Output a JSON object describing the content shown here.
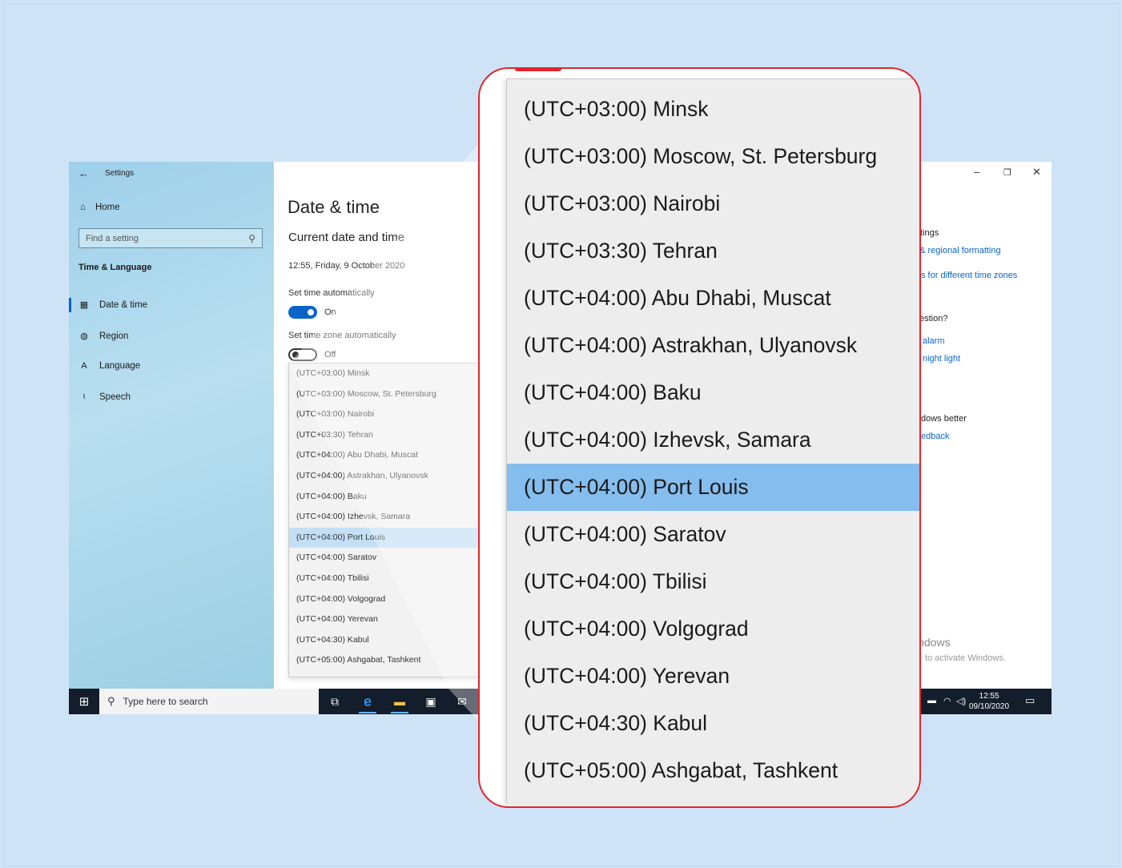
{
  "window": {
    "title": "Settings",
    "minimize": "–",
    "restore": "❐",
    "close": "✕"
  },
  "sidebar": {
    "back_icon": "arrow-left-icon",
    "home_label": "Home",
    "search_placeholder": "Find a setting",
    "section": "Time & Language",
    "items": [
      {
        "label": "Date & time",
        "icon": "calendar-icon",
        "active": true
      },
      {
        "label": "Region",
        "icon": "globe-icon",
        "active": false
      },
      {
        "label": "Language",
        "icon": "language-icon",
        "active": false
      },
      {
        "label": "Speech",
        "icon": "microphone-icon",
        "active": false
      }
    ]
  },
  "main": {
    "title": "Date & time",
    "subtitle": "Current date and time",
    "current_datetime": "12:55, Friday, 9 October 2020",
    "set_time_auto_label": "Set time automatically",
    "set_time_auto_state": "On",
    "set_tz_auto_label": "Set time zone automatically",
    "set_tz_auto_state": "Off"
  },
  "timezones": {
    "selected": "(UTC+04:00) Port Louis",
    "options": [
      "(UTC+03:00) Minsk",
      "(UTC+03:00) Moscow, St. Petersburg",
      "(UTC+03:00) Nairobi",
      "(UTC+03:30) Tehran",
      "(UTC+04:00) Abu Dhabi, Muscat",
      "(UTC+04:00) Astrakhan, Ulyanovsk",
      "(UTC+04:00) Baku",
      "(UTC+04:00) Izhevsk, Samara",
      "(UTC+04:00) Port Louis",
      "(UTC+04:00) Saratov",
      "(UTC+04:00) Tbilisi",
      "(UTC+04:00) Volgograd",
      "(UTC+04:00) Yerevan",
      "(UTC+04:30) Kabul",
      "(UTC+05:00) Ashgabat, Tashkent"
    ]
  },
  "right_panel": {
    "related_heading_partial": "ttings",
    "link1_partial": ", & regional formatting",
    "link2_partial": "s for different time zones",
    "question_partial": "estion?",
    "link3_partial": "alarm",
    "link4_partial": "night light",
    "better_partial": "dows better",
    "feedback_partial": "edback",
    "activate_title_partial": "indows",
    "activate_sub_partial": "to activate Windows."
  },
  "taskbar": {
    "search_placeholder": "Type here to search",
    "time": "12:55",
    "date": "09/10/2020",
    "icons": [
      "windows-start-icon",
      "search-icon",
      "task-view-icon",
      "edge-icon",
      "file-explorer-icon",
      "store-icon",
      "mail-icon",
      "notification-icon"
    ]
  },
  "colors": {
    "accent": "#0a64c8",
    "highlight_frame": "#e3242b",
    "selected_row": "#85bdee",
    "background": "#cfe3f7"
  }
}
